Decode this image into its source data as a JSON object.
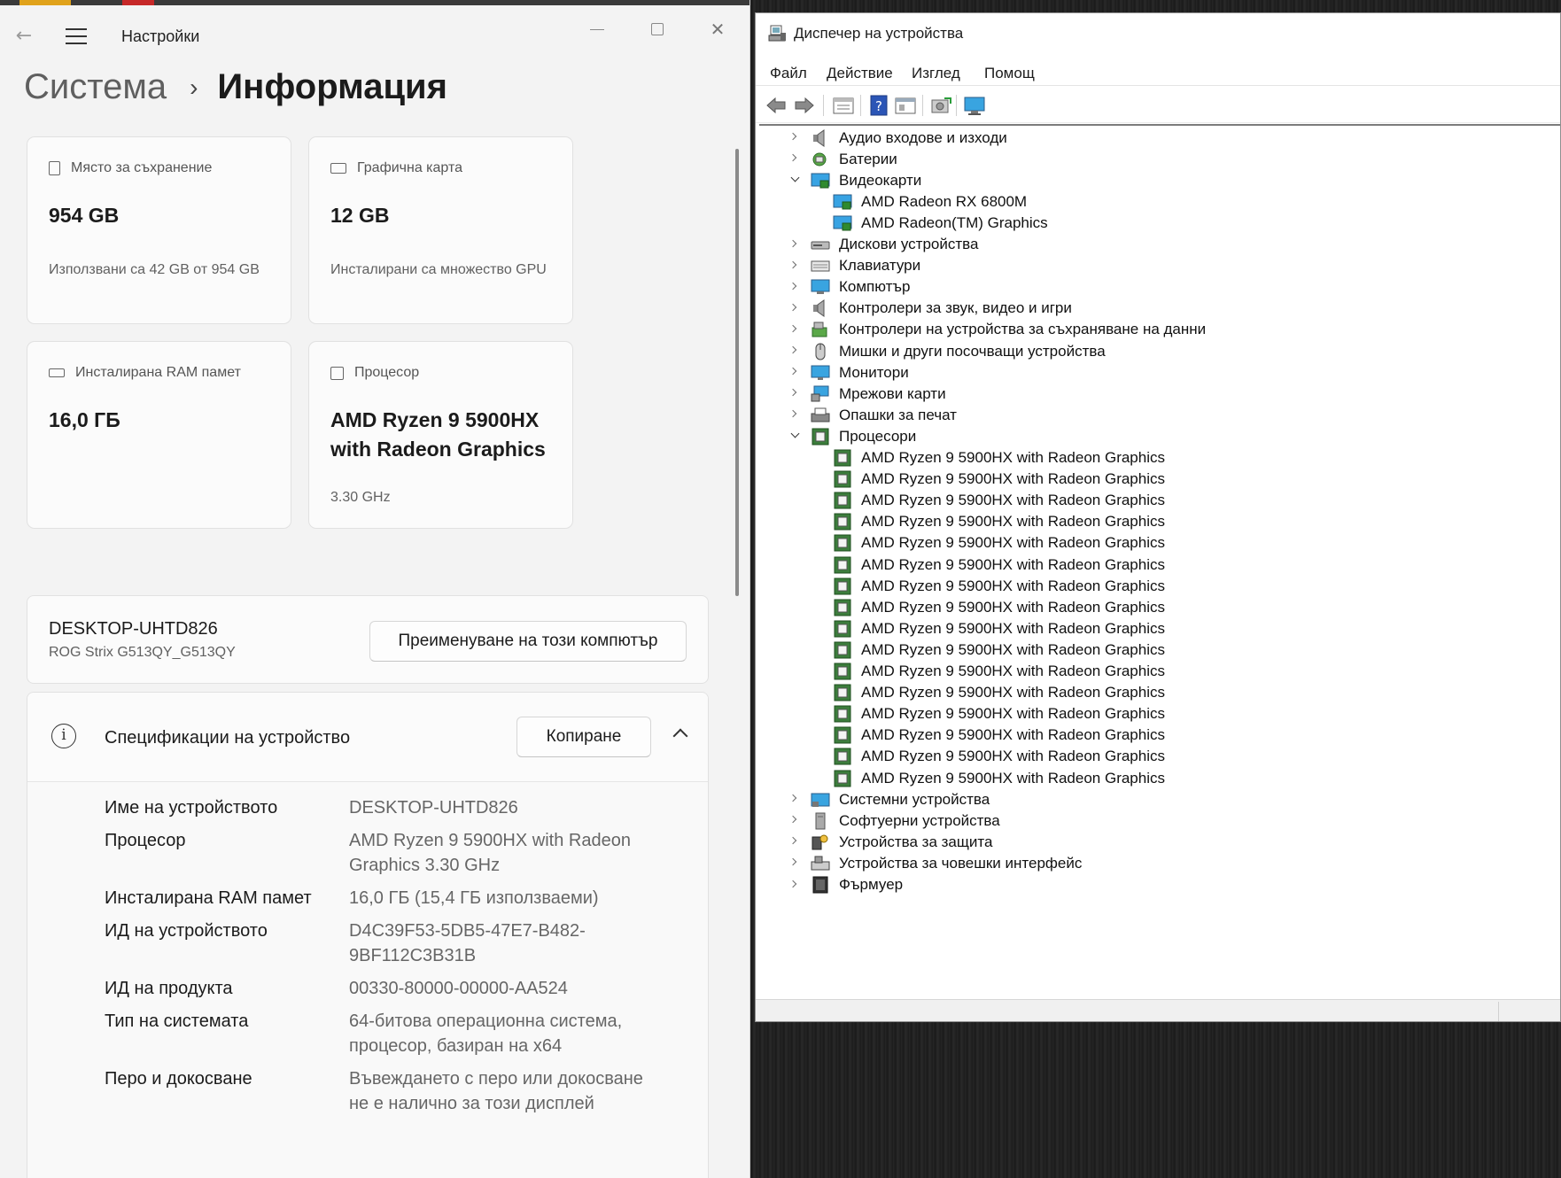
{
  "settings": {
    "app_title": "Настройки",
    "breadcrumb": {
      "parent": "Система",
      "current": "Информация"
    },
    "cards": {
      "storage": {
        "label": "Място за съхранение",
        "value": "954 GB",
        "sub": "Използвани са 42 GB от 954 GB"
      },
      "gpu": {
        "label": "Графична карта",
        "value": "12 GB",
        "sub": "Инсталирани са множество GPU"
      },
      "ram": {
        "label": "Инсталирана RAM памет",
        "value": "16,0 ГБ"
      },
      "cpu": {
        "label": "Процесор",
        "value": "AMD Ryzen 9 5900HX with Radeon Graphics",
        "sub": "3.30 GHz"
      }
    },
    "pc": {
      "name": "DESKTOP-UHTD826",
      "model": "ROG Strix G513QY_G513QY",
      "rename_button": "Преименуване на този компютър"
    },
    "specs": {
      "title": "Спецификации на устройство",
      "copy_button": "Копиране",
      "rows": [
        {
          "key": "Име на устройството",
          "value": "DESKTOP-UHTD826"
        },
        {
          "key": "Процесор",
          "value": "AMD Ryzen 9 5900HX with Radeon Graphics           3.30 GHz"
        },
        {
          "key": "Инсталирана RAM памет",
          "value": "16,0 ГБ (15,4 ГБ използваеми)"
        },
        {
          "key": "ИД на устройството",
          "value": "D4C39F53-5DB5-47E7-B482-9BF112C3B31B"
        },
        {
          "key": "ИД на продукта",
          "value": "00330-80000-00000-AA524"
        },
        {
          "key": "Тип на системата",
          "value": "64-битова операционна система, процесор, базиран на x64"
        },
        {
          "key": "Перо и докосване",
          "value": "Въвеждането с перо или докосване не е налично за този дисплей"
        }
      ]
    }
  },
  "device_manager": {
    "title": "Диспечер на устройства",
    "menu": [
      "Файл",
      "Действие",
      "Изглед",
      "Помощ"
    ],
    "toolbar_icons": [
      "back-arrow-icon",
      "forward-arrow-icon",
      "properties-icon",
      "help-icon",
      "view-icon",
      "update-driver-icon",
      "monitor-icon"
    ],
    "tree": [
      {
        "label": "Аудио входове и изходи",
        "icon": "speaker-icon",
        "level": 0,
        "state": "closed"
      },
      {
        "label": "Батерии",
        "icon": "battery-icon",
        "level": 0,
        "state": "closed"
      },
      {
        "label": "Видеокарти",
        "icon": "display-adapter-icon",
        "level": 0,
        "state": "open"
      },
      {
        "label": "AMD Radeon RX 6800M",
        "icon": "display-adapter-icon",
        "level": 1
      },
      {
        "label": "AMD Radeon(TM) Graphics",
        "icon": "display-adapter-icon",
        "level": 1
      },
      {
        "label": "Дискови устройства",
        "icon": "disk-drive-icon",
        "level": 0,
        "state": "closed"
      },
      {
        "label": "Клавиатури",
        "icon": "keyboard-icon",
        "level": 0,
        "state": "closed"
      },
      {
        "label": "Компютър",
        "icon": "computer-icon",
        "level": 0,
        "state": "closed"
      },
      {
        "label": "Контролери за звук, видео и игри",
        "icon": "speaker-icon",
        "level": 0,
        "state": "closed"
      },
      {
        "label": "Контролери на устройства за съхраняване на данни",
        "icon": "storage-controller-icon",
        "level": 0,
        "state": "closed"
      },
      {
        "label": "Мишки и други посочващи устройства",
        "icon": "mouse-icon",
        "level": 0,
        "state": "closed"
      },
      {
        "label": "Монитори",
        "icon": "monitor-icon",
        "level": 0,
        "state": "closed"
      },
      {
        "label": "Мрежови карти",
        "icon": "network-icon",
        "level": 0,
        "state": "closed"
      },
      {
        "label": "Опашки за печат",
        "icon": "printer-icon",
        "level": 0,
        "state": "closed"
      },
      {
        "label": "Процесори",
        "icon": "processor-icon",
        "level": 0,
        "state": "open"
      },
      {
        "label": "AMD Ryzen 9 5900HX with Radeon Graphics",
        "icon": "processor-icon",
        "level": 1
      },
      {
        "label": "AMD Ryzen 9 5900HX with Radeon Graphics",
        "icon": "processor-icon",
        "level": 1
      },
      {
        "label": "AMD Ryzen 9 5900HX with Radeon Graphics",
        "icon": "processor-icon",
        "level": 1
      },
      {
        "label": "AMD Ryzen 9 5900HX with Radeon Graphics",
        "icon": "processor-icon",
        "level": 1
      },
      {
        "label": "AMD Ryzen 9 5900HX with Radeon Graphics",
        "icon": "processor-icon",
        "level": 1
      },
      {
        "label": "AMD Ryzen 9 5900HX with Radeon Graphics",
        "icon": "processor-icon",
        "level": 1
      },
      {
        "label": "AMD Ryzen 9 5900HX with Radeon Graphics",
        "icon": "processor-icon",
        "level": 1
      },
      {
        "label": "AMD Ryzen 9 5900HX with Radeon Graphics",
        "icon": "processor-icon",
        "level": 1
      },
      {
        "label": "AMD Ryzen 9 5900HX with Radeon Graphics",
        "icon": "processor-icon",
        "level": 1
      },
      {
        "label": "AMD Ryzen 9 5900HX with Radeon Graphics",
        "icon": "processor-icon",
        "level": 1
      },
      {
        "label": "AMD Ryzen 9 5900HX with Radeon Graphics",
        "icon": "processor-icon",
        "level": 1
      },
      {
        "label": "AMD Ryzen 9 5900HX with Radeon Graphics",
        "icon": "processor-icon",
        "level": 1
      },
      {
        "label": "AMD Ryzen 9 5900HX with Radeon Graphics",
        "icon": "processor-icon",
        "level": 1
      },
      {
        "label": "AMD Ryzen 9 5900HX with Radeon Graphics",
        "icon": "processor-icon",
        "level": 1
      },
      {
        "label": "AMD Ryzen 9 5900HX with Radeon Graphics",
        "icon": "processor-icon",
        "level": 1
      },
      {
        "label": "AMD Ryzen 9 5900HX with Radeon Graphics",
        "icon": "processor-icon",
        "level": 1
      },
      {
        "label": "Системни устройства",
        "icon": "system-device-icon",
        "level": 0,
        "state": "closed"
      },
      {
        "label": "Софтуерни устройства",
        "icon": "software-device-icon",
        "level": 0,
        "state": "closed"
      },
      {
        "label": "Устройства за защита",
        "icon": "security-device-icon",
        "level": 0,
        "state": "closed"
      },
      {
        "label": "Устройства за човешки интерфейс",
        "icon": "hid-icon",
        "level": 0,
        "state": "closed"
      },
      {
        "label": "Фърмуер",
        "icon": "firmware-icon",
        "level": 0,
        "state": "closed"
      }
    ]
  }
}
